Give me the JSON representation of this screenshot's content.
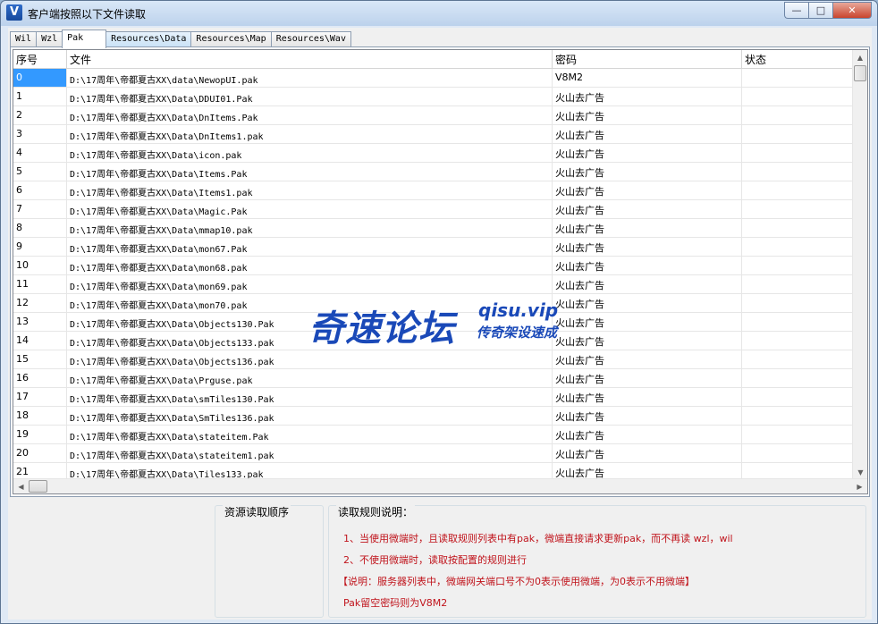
{
  "window": {
    "title": "客户端按照以下文件读取",
    "icon_letter": "V",
    "minimize": "—",
    "maximize": "□",
    "close": "✕"
  },
  "tabs": [
    {
      "label": "Wil"
    },
    {
      "label": "Wzl"
    },
    {
      "label": "Pak",
      "active": true
    },
    {
      "label": "Resources\\Data"
    },
    {
      "label": "Resources\\Map"
    },
    {
      "label": "Resources\\Wav"
    }
  ],
  "table": {
    "headers": {
      "index": "序号",
      "file": "文件",
      "password": "密码",
      "status": "状态"
    },
    "rows": [
      {
        "index": "0",
        "file": "D:\\17周年\\帝都夏古XX\\data\\NewopUI.pak",
        "password": "V8M2",
        "status": ""
      },
      {
        "index": "1",
        "file": "D:\\17周年\\帝都夏古XX\\Data\\DDUI01.Pak",
        "password": "火山去广告",
        "status": ""
      },
      {
        "index": "2",
        "file": "D:\\17周年\\帝都夏古XX\\Data\\DnItems.Pak",
        "password": "火山去广告",
        "status": ""
      },
      {
        "index": "3",
        "file": "D:\\17周年\\帝都夏古XX\\Data\\DnItems1.pak",
        "password": "火山去广告",
        "status": ""
      },
      {
        "index": "4",
        "file": "D:\\17周年\\帝都夏古XX\\Data\\icon.pak",
        "password": "火山去广告",
        "status": ""
      },
      {
        "index": "5",
        "file": "D:\\17周年\\帝都夏古XX\\Data\\Items.Pak",
        "password": "火山去广告",
        "status": ""
      },
      {
        "index": "6",
        "file": "D:\\17周年\\帝都夏古XX\\Data\\Items1.pak",
        "password": "火山去广告",
        "status": ""
      },
      {
        "index": "7",
        "file": "D:\\17周年\\帝都夏古XX\\Data\\Magic.Pak",
        "password": "火山去广告",
        "status": ""
      },
      {
        "index": "8",
        "file": "D:\\17周年\\帝都夏古XX\\Data\\mmap10.pak",
        "password": "火山去广告",
        "status": ""
      },
      {
        "index": "9",
        "file": "D:\\17周年\\帝都夏古XX\\Data\\mon67.Pak",
        "password": "火山去广告",
        "status": ""
      },
      {
        "index": "10",
        "file": "D:\\17周年\\帝都夏古XX\\Data\\mon68.pak",
        "password": "火山去广告",
        "status": ""
      },
      {
        "index": "11",
        "file": "D:\\17周年\\帝都夏古XX\\Data\\mon69.pak",
        "password": "火山去广告",
        "status": ""
      },
      {
        "index": "12",
        "file": "D:\\17周年\\帝都夏古XX\\Data\\mon70.pak",
        "password": "火山去广告",
        "status": ""
      },
      {
        "index": "13",
        "file": "D:\\17周年\\帝都夏古XX\\Data\\Objects130.Pak",
        "password": "火山去广告",
        "status": ""
      },
      {
        "index": "14",
        "file": "D:\\17周年\\帝都夏古XX\\Data\\Objects133.pak",
        "password": "火山去广告",
        "status": ""
      },
      {
        "index": "15",
        "file": "D:\\17周年\\帝都夏古XX\\Data\\Objects136.pak",
        "password": "火山去广告",
        "status": ""
      },
      {
        "index": "16",
        "file": "D:\\17周年\\帝都夏古XX\\Data\\Prguse.pak",
        "password": "火山去广告",
        "status": ""
      },
      {
        "index": "17",
        "file": "D:\\17周年\\帝都夏古XX\\Data\\smTiles130.Pak",
        "password": "火山去广告",
        "status": ""
      },
      {
        "index": "18",
        "file": "D:\\17周年\\帝都夏古XX\\Data\\SmTiles136.pak",
        "password": "火山去广告",
        "status": ""
      },
      {
        "index": "19",
        "file": "D:\\17周年\\帝都夏古XX\\Data\\stateitem.Pak",
        "password": "火山去广告",
        "status": ""
      },
      {
        "index": "20",
        "file": "D:\\17周年\\帝都夏古XX\\Data\\stateitem1.pak",
        "password": "火山去广告",
        "status": ""
      },
      {
        "index": "21",
        "file": "D:\\17周年\\帝都夏古XX\\Data\\Tiles133.pak",
        "password": "火山去广告",
        "status": ""
      }
    ]
  },
  "watermark": {
    "main": "奇速论坛",
    "url": "qisu.vip",
    "sub": "传奇架设速成"
  },
  "bottom": {
    "order_title": "资源读取顺序",
    "rules_title": "读取规则说明：",
    "rules": [
      "1、当使用微端时，且读取规则列表中有pak，微端直接请求更新pak，而不再读 wzl，wil",
      "2、不使用微端时，读取按配置的规则进行",
      "【说明：服务器列表中，微端网关端口号不为0表示使用微端，为0表示不用微端】",
      "Pak留空密码则为V8M2"
    ]
  },
  "colors": {
    "selection": "#3399ff",
    "rule_text": "#c0141c",
    "watermark": "#1a49b8"
  }
}
